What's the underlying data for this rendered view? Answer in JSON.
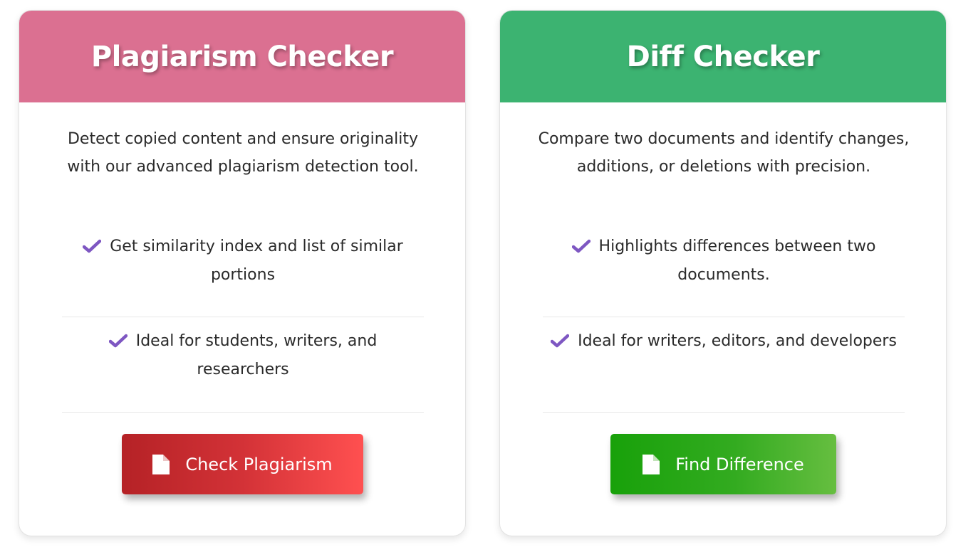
{
  "colors": {
    "plagiarism_header": "#db7091",
    "diff_header": "#3cb371",
    "check_icon": "#7e57c2",
    "plagiarism_button_start": "#b22222",
    "plagiarism_button_end": "#ff4f4f",
    "diff_button_start": "#16a00a",
    "diff_button_end": "#66bd3f"
  },
  "plagiarism": {
    "title": "Plagiarism Checker",
    "description": "Detect copied content and ensure originality with our advanced plagiarism detection tool.",
    "features": [
      "Get similarity index and list of similar portions",
      "Ideal for students, writers, and researchers"
    ],
    "button_label": "Check Plagiarism",
    "button_icon": "file-icon"
  },
  "diff": {
    "title": "Diff Checker",
    "description": "Compare two documents and identify changes, additions, or deletions with precision.",
    "features": [
      "Highlights differences between two documents.",
      "Ideal for writers, editors, and developers"
    ],
    "button_label": "Find Difference",
    "button_icon": "file-icon"
  }
}
